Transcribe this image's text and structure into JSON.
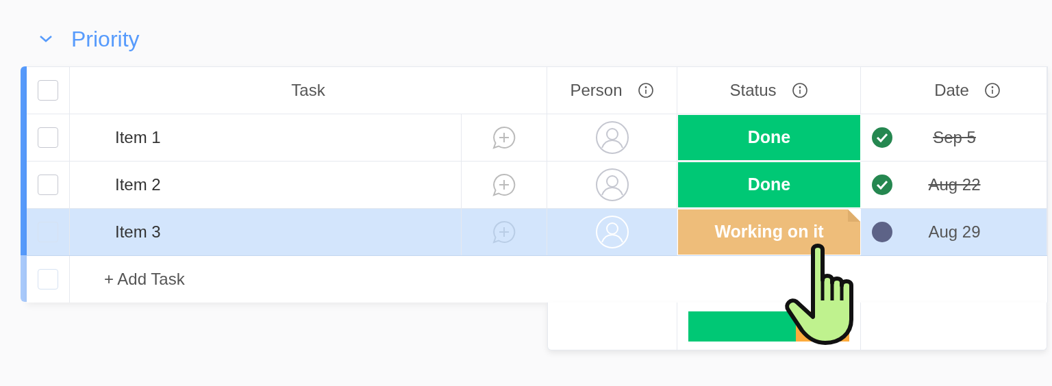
{
  "group": {
    "title": "Priority",
    "expanded": true
  },
  "select_all": {
    "checked": false
  },
  "columns": [
    {
      "label": "Task",
      "kind": "plain"
    },
    {
      "label": "Person",
      "kind": "info"
    },
    {
      "label": "Status",
      "kind": "info"
    },
    {
      "label": "Date",
      "kind": "info"
    }
  ],
  "rows": [
    {
      "name": "Item 1",
      "checked": false,
      "selected": false,
      "status": {
        "label": "Done",
        "color": "#00c875"
      },
      "date": "Sep 5",
      "done": true
    },
    {
      "name": "Item 2",
      "checked": false,
      "selected": false,
      "status": {
        "label": "Done",
        "color": "#00c875"
      },
      "date": "Aug 22",
      "done": true
    },
    {
      "name": "Item 3",
      "checked": false,
      "selected": true,
      "status": {
        "label": "Working on it",
        "color": "#eebd7a"
      },
      "date": "Aug 29",
      "done": false
    }
  ],
  "add_task": {
    "label": "+ Add Task",
    "checked": false
  },
  "summary": [
    {
      "color": "#00c875",
      "level": 0.67
    },
    {
      "color": "#fdab3d",
      "level": 0.33
    }
  ]
}
